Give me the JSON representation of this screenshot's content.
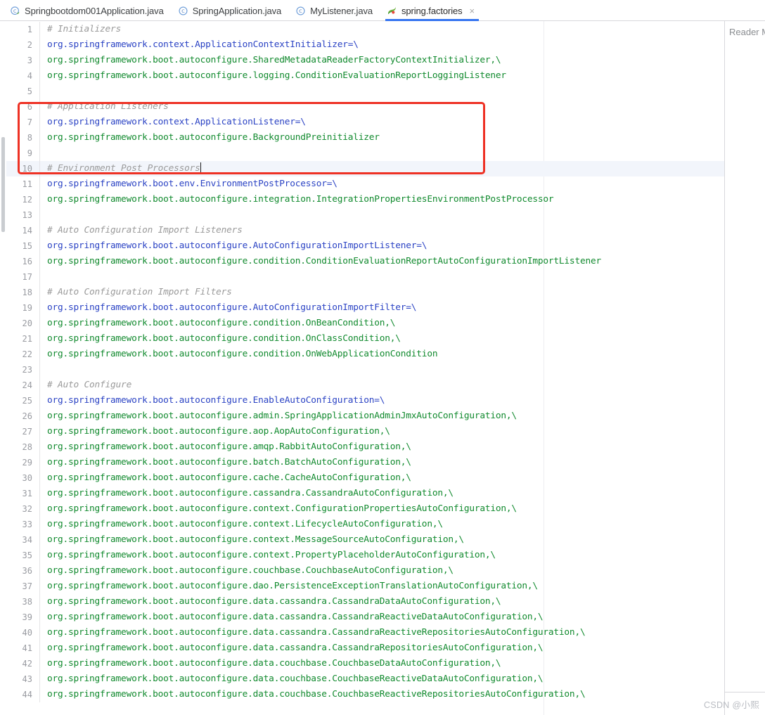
{
  "tabs": [
    {
      "label": "Springbootdom001Application.java",
      "icon": "java-class-spring-boot-icon",
      "active": false,
      "closable": false
    },
    {
      "label": "SpringApplication.java",
      "icon": "java-class-icon",
      "active": false,
      "closable": false
    },
    {
      "label": "MyListener.java",
      "icon": "java-class-icon",
      "active": false,
      "closable": false
    },
    {
      "label": "spring.factories",
      "icon": "spring-leaf-icon",
      "active": true,
      "closable": true,
      "close_label": "×"
    }
  ],
  "right_panel": {
    "label": "Reader M"
  },
  "watermark": "CSDN @小熙",
  "colors": {
    "accent": "#3574f0",
    "annotation": "#ee3124",
    "comment": "#9a9a9a",
    "key": "#2b43c4",
    "value": "#118a2e",
    "current_line": "#f2f5fb"
  },
  "editor": {
    "filename": "spring.factories",
    "caret_line": 10,
    "lines": [
      {
        "n": "1",
        "type": "comment",
        "text": "# Initializers"
      },
      {
        "n": "2",
        "type": "key",
        "text": "org.springframework.context.ApplicationContextInitializer=\\"
      },
      {
        "n": "3",
        "type": "value",
        "text": "org.springframework.boot.autoconfigure.SharedMetadataReaderFactoryContextInitializer,\\"
      },
      {
        "n": "4",
        "type": "value",
        "text": "org.springframework.boot.autoconfigure.logging.ConditionEvaluationReportLoggingListener"
      },
      {
        "n": "5",
        "type": "plain",
        "text": ""
      },
      {
        "n": "6",
        "type": "comment",
        "text": "# Application Listeners"
      },
      {
        "n": "7",
        "type": "key",
        "text": "org.springframework.context.ApplicationListener=\\"
      },
      {
        "n": "8",
        "type": "value",
        "text": "org.springframework.boot.autoconfigure.BackgroundPreinitializer"
      },
      {
        "n": "9",
        "type": "plain",
        "text": ""
      },
      {
        "n": "10",
        "type": "comment",
        "text": "# Environment Post Processors",
        "caret": true
      },
      {
        "n": "11",
        "type": "key",
        "text": "org.springframework.boot.env.EnvironmentPostProcessor=\\"
      },
      {
        "n": "12",
        "type": "value",
        "text": "org.springframework.boot.autoconfigure.integration.IntegrationPropertiesEnvironmentPostProcessor"
      },
      {
        "n": "13",
        "type": "plain",
        "text": ""
      },
      {
        "n": "14",
        "type": "comment",
        "text": "# Auto Configuration Import Listeners"
      },
      {
        "n": "15",
        "type": "key",
        "text": "org.springframework.boot.autoconfigure.AutoConfigurationImportListener=\\"
      },
      {
        "n": "16",
        "type": "value",
        "text": "org.springframework.boot.autoconfigure.condition.ConditionEvaluationReportAutoConfigurationImportListener"
      },
      {
        "n": "17",
        "type": "plain",
        "text": ""
      },
      {
        "n": "18",
        "type": "comment",
        "text": "# Auto Configuration Import Filters"
      },
      {
        "n": "19",
        "type": "key",
        "text": "org.springframework.boot.autoconfigure.AutoConfigurationImportFilter=\\"
      },
      {
        "n": "20",
        "type": "value",
        "text": "org.springframework.boot.autoconfigure.condition.OnBeanCondition,\\"
      },
      {
        "n": "21",
        "type": "value",
        "text": "org.springframework.boot.autoconfigure.condition.OnClassCondition,\\"
      },
      {
        "n": "22",
        "type": "value",
        "text": "org.springframework.boot.autoconfigure.condition.OnWebApplicationCondition"
      },
      {
        "n": "23",
        "type": "plain",
        "text": ""
      },
      {
        "n": "24",
        "type": "comment",
        "text": "# Auto Configure"
      },
      {
        "n": "25",
        "type": "key",
        "text": "org.springframework.boot.autoconfigure.EnableAutoConfiguration=\\"
      },
      {
        "n": "26",
        "type": "value",
        "text": "org.springframework.boot.autoconfigure.admin.SpringApplicationAdminJmxAutoConfiguration,\\"
      },
      {
        "n": "27",
        "type": "value",
        "text": "org.springframework.boot.autoconfigure.aop.AopAutoConfiguration,\\"
      },
      {
        "n": "28",
        "type": "value",
        "text": "org.springframework.boot.autoconfigure.amqp.RabbitAutoConfiguration,\\"
      },
      {
        "n": "29",
        "type": "value",
        "text": "org.springframework.boot.autoconfigure.batch.BatchAutoConfiguration,\\"
      },
      {
        "n": "30",
        "type": "value",
        "text": "org.springframework.boot.autoconfigure.cache.CacheAutoConfiguration,\\"
      },
      {
        "n": "31",
        "type": "value",
        "text": "org.springframework.boot.autoconfigure.cassandra.CassandraAutoConfiguration,\\"
      },
      {
        "n": "32",
        "type": "value",
        "text": "org.springframework.boot.autoconfigure.context.ConfigurationPropertiesAutoConfiguration,\\"
      },
      {
        "n": "33",
        "type": "value",
        "text": "org.springframework.boot.autoconfigure.context.LifecycleAutoConfiguration,\\"
      },
      {
        "n": "34",
        "type": "value",
        "text": "org.springframework.boot.autoconfigure.context.MessageSourceAutoConfiguration,\\"
      },
      {
        "n": "35",
        "type": "value",
        "text": "org.springframework.boot.autoconfigure.context.PropertyPlaceholderAutoConfiguration,\\"
      },
      {
        "n": "36",
        "type": "value",
        "text": "org.springframework.boot.autoconfigure.couchbase.CouchbaseAutoConfiguration,\\"
      },
      {
        "n": "37",
        "type": "value",
        "text": "org.springframework.boot.autoconfigure.dao.PersistenceExceptionTranslationAutoConfiguration,\\"
      },
      {
        "n": "38",
        "type": "value",
        "text": "org.springframework.boot.autoconfigure.data.cassandra.CassandraDataAutoConfiguration,\\"
      },
      {
        "n": "39",
        "type": "value",
        "text": "org.springframework.boot.autoconfigure.data.cassandra.CassandraReactiveDataAutoConfiguration,\\"
      },
      {
        "n": "40",
        "type": "value",
        "text": "org.springframework.boot.autoconfigure.data.cassandra.CassandraReactiveRepositoriesAutoConfiguration,\\"
      },
      {
        "n": "41",
        "type": "value",
        "text": "org.springframework.boot.autoconfigure.data.cassandra.CassandraRepositoriesAutoConfiguration,\\"
      },
      {
        "n": "42",
        "type": "value",
        "text": "org.springframework.boot.autoconfigure.data.couchbase.CouchbaseDataAutoConfiguration,\\"
      },
      {
        "n": "43",
        "type": "value",
        "text": "org.springframework.boot.autoconfigure.data.couchbase.CouchbaseReactiveDataAutoConfiguration,\\"
      },
      {
        "n": "44",
        "type": "value",
        "text": "org.springframework.boot.autoconfigure.data.couchbase.CouchbaseReactiveRepositoriesAutoConfiguration,\\"
      }
    ]
  }
}
